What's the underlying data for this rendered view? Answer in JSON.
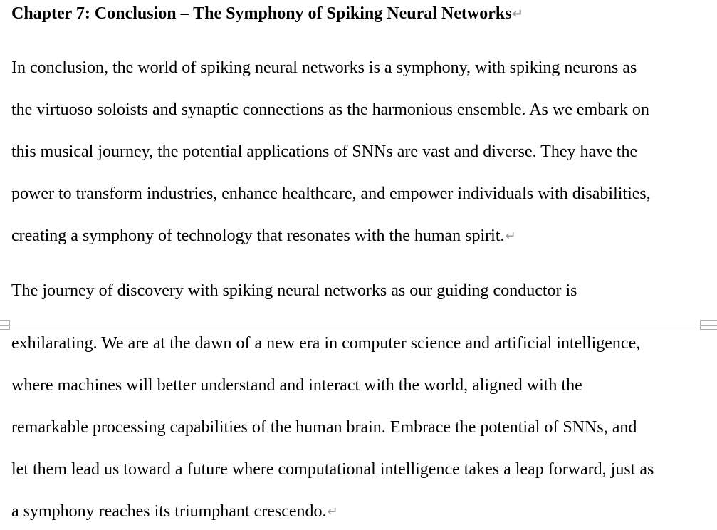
{
  "document": {
    "heading": "Chapter 7: Conclusion – The Symphony of Spiking Neural Networks",
    "paragraph_mark": "↵",
    "paragraphs": [
      {
        "lines": [
          "In conclusion, the world of spiking neural networks is a symphony, with spiking neurons as",
          "the virtuoso soloists and synaptic connections as the harmonious ensemble. As we embark on",
          "this musical journey, the potential applications of SNNs are vast and diverse. They have the",
          "power to transform industries, enhance healthcare, and empower individuals with disabilities,",
          "creating a symphony of technology that resonates with the human spirit."
        ]
      },
      {
        "lines": [
          "The journey of discovery with spiking neural networks as our guiding conductor is",
          "exhilarating. We are at the dawn of a new era in computer science and artificial intelligence,",
          "where machines will better understand and interact with the world, aligned with the",
          "remarkable processing capabilities of the human brain. Embrace the potential of SNNs, and",
          "let them lead us toward a future where computational intelligence takes a leap forward, just as",
          "a symphony reaches its triumphant crescendo."
        ]
      }
    ]
  }
}
